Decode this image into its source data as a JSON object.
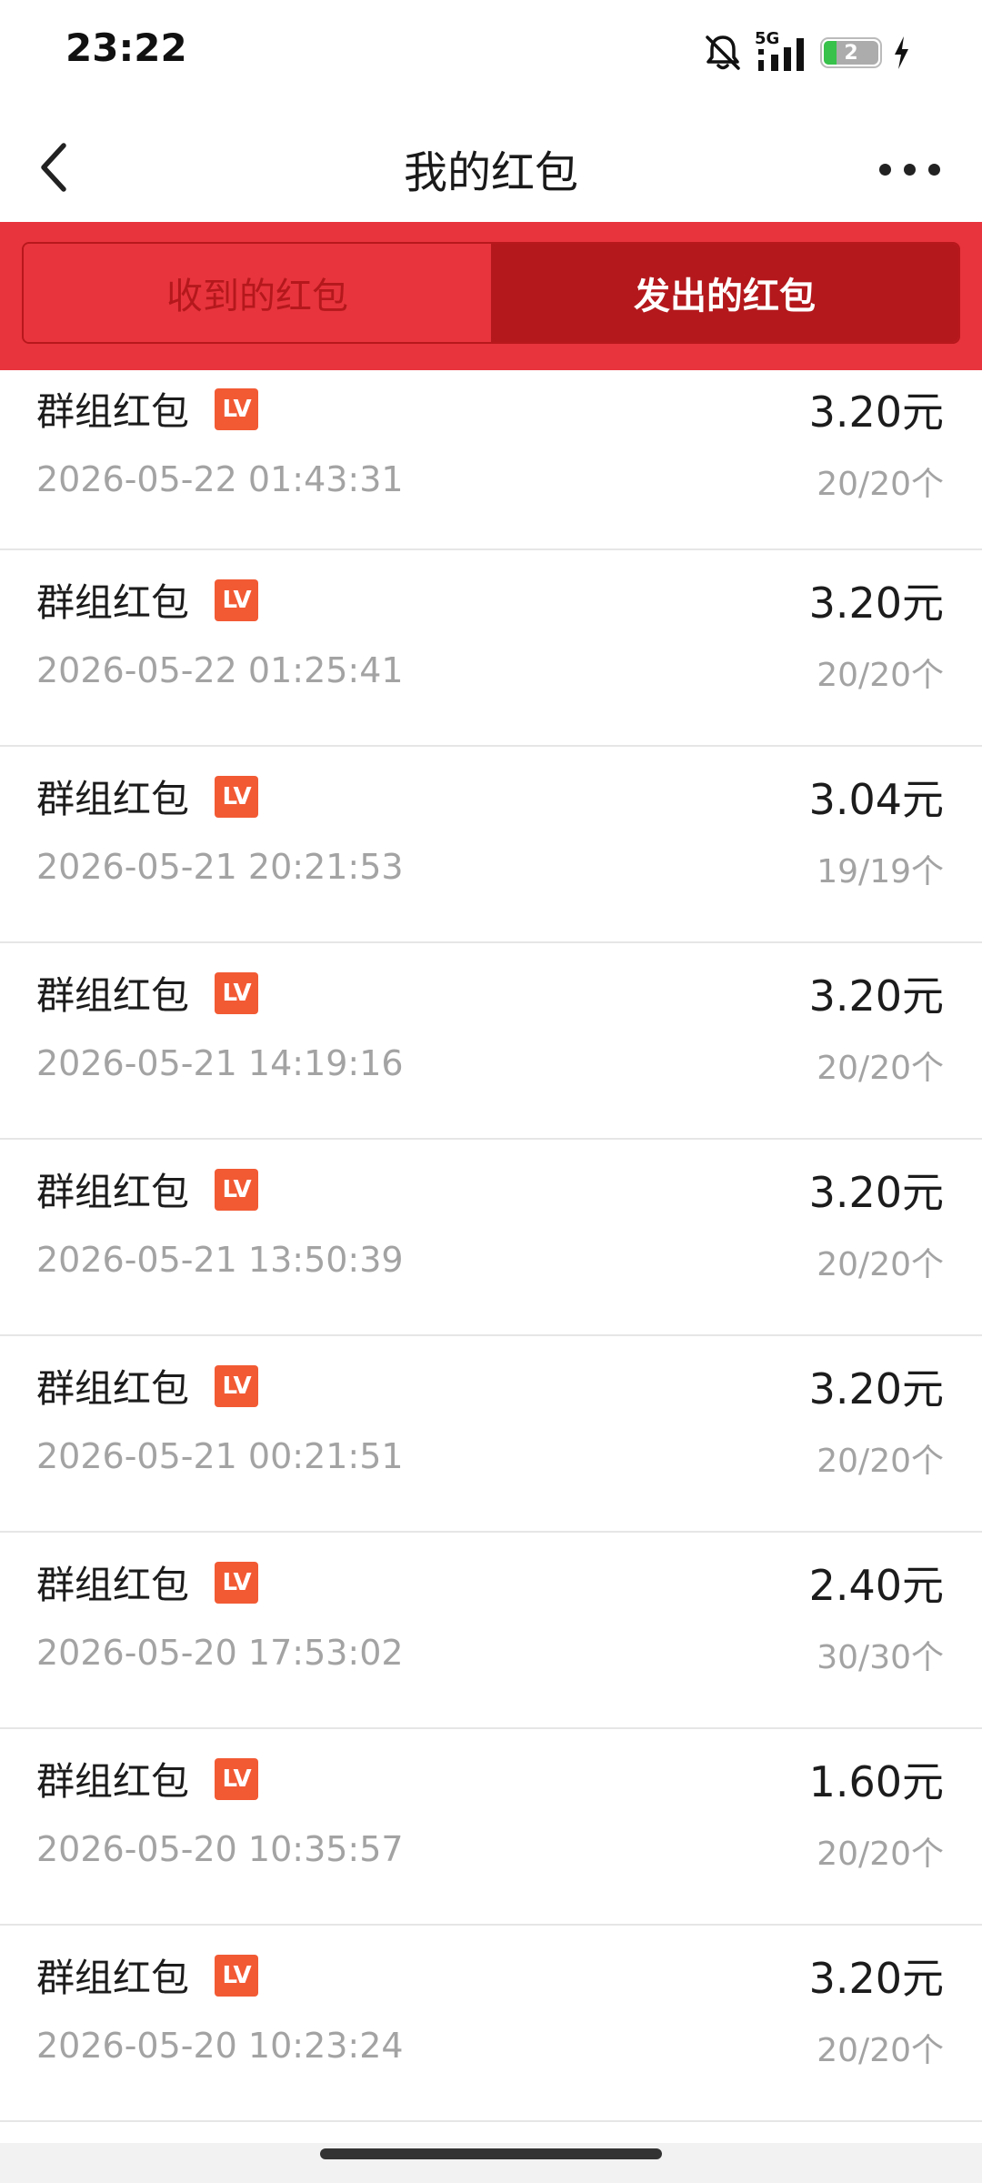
{
  "status": {
    "time": "23:22",
    "network": "5G",
    "battery": "2",
    "icons": [
      "mute-bell-icon",
      "signal-icon",
      "battery-icon",
      "charging-icon"
    ]
  },
  "header": {
    "title": "我的红包",
    "back_icon": "chevron-left-icon",
    "more_icon": "more-horizontal-icon"
  },
  "tabs": [
    {
      "label": "收到的红包",
      "active": false
    },
    {
      "label": "发出的红包",
      "active": true
    }
  ],
  "colors": {
    "brand_red": "#e8343d",
    "active_tab": "#b4181c",
    "badge": "#f25a34"
  },
  "items": [
    {
      "title": "群组红包",
      "badge": "LV",
      "time": "2026-05-22 01:43:31",
      "amount": "3.20元",
      "count": "20/20个"
    },
    {
      "title": "群组红包",
      "badge": "LV",
      "time": "2026-05-22 01:25:41",
      "amount": "3.20元",
      "count": "20/20个"
    },
    {
      "title": "群组红包",
      "badge": "LV",
      "time": "2026-05-21 20:21:53",
      "amount": "3.04元",
      "count": "19/19个"
    },
    {
      "title": "群组红包",
      "badge": "LV",
      "time": "2026-05-21 14:19:16",
      "amount": "3.20元",
      "count": "20/20个"
    },
    {
      "title": "群组红包",
      "badge": "LV",
      "time": "2026-05-21 13:50:39",
      "amount": "3.20元",
      "count": "20/20个"
    },
    {
      "title": "群组红包",
      "badge": "LV",
      "time": "2026-05-21 00:21:51",
      "amount": "3.20元",
      "count": "20/20个"
    },
    {
      "title": "群组红包",
      "badge": "LV",
      "time": "2026-05-20 17:53:02",
      "amount": "2.40元",
      "count": "30/30个"
    },
    {
      "title": "群组红包",
      "badge": "LV",
      "time": "2026-05-20 10:35:57",
      "amount": "1.60元",
      "count": "20/20个"
    },
    {
      "title": "群组红包",
      "badge": "LV",
      "time": "2026-05-20 10:23:24",
      "amount": "3.20元",
      "count": "20/20个"
    }
  ]
}
